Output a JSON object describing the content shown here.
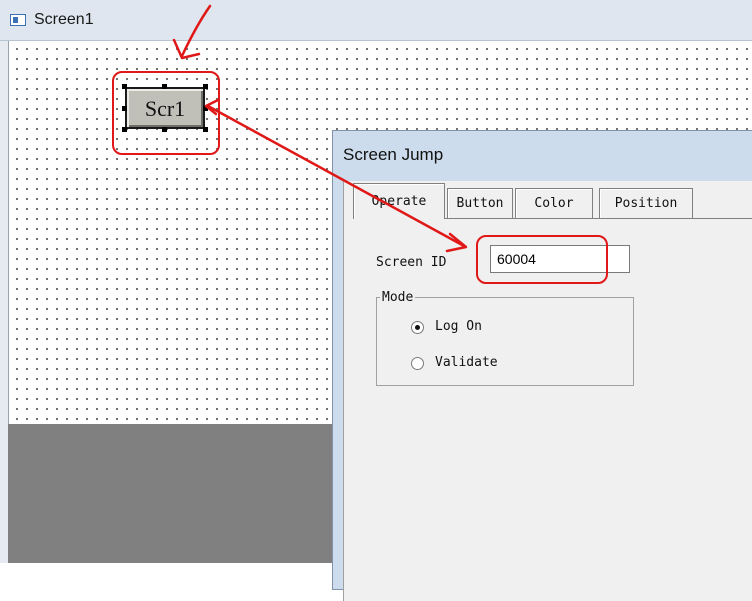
{
  "window": {
    "title": "Screen1"
  },
  "component": {
    "label": "Scr1"
  },
  "dialog": {
    "title": "Screen Jump",
    "tabs": [
      {
        "label": "Operate",
        "active": true
      },
      {
        "label": "Button",
        "active": false
      },
      {
        "label": "Color",
        "active": false
      },
      {
        "label": "Position",
        "active": false
      }
    ],
    "screen_id_label": "Screen ID",
    "screen_id_value": "60004",
    "mode": {
      "title": "Mode",
      "options": [
        {
          "label": "Log On",
          "selected": true
        },
        {
          "label": "Validate",
          "selected": false
        }
      ]
    }
  },
  "colors": {
    "annotation": "#e01818",
    "dialog_frame": "#ccdcec",
    "canvas_gray": "#808080"
  },
  "icons": [
    "window-icon",
    "radio-selected-icon",
    "radio-unselected-icon"
  ]
}
